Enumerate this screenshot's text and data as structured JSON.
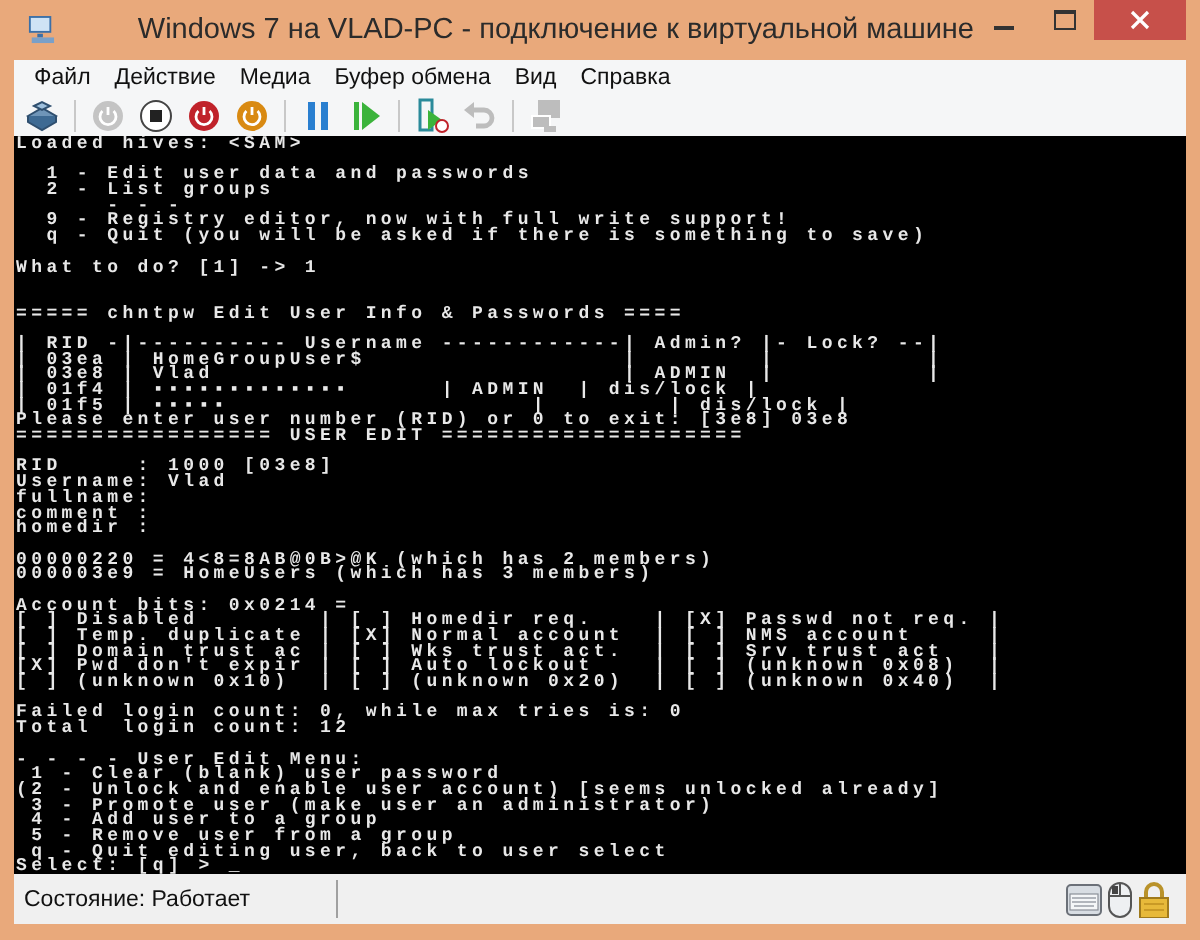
{
  "window": {
    "title": "Windows 7 на VLAD-PC - подключение к виртуальной машине"
  },
  "menu": [
    "Файл",
    "Действие",
    "Медиа",
    "Буфер обмена",
    "Вид",
    "Справка"
  ],
  "toolbar": [
    [
      {
        "kind": "ctrl-alt-del",
        "disabled": false
      }
    ],
    [
      {
        "kind": "start",
        "disabled": true
      },
      {
        "kind": "turn-off",
        "disabled": false
      },
      {
        "kind": "shut-down",
        "disabled": false
      },
      {
        "kind": "save",
        "disabled": false
      }
    ],
    [
      {
        "kind": "pause",
        "disabled": false
      },
      {
        "kind": "reset",
        "disabled": false
      }
    ],
    [
      {
        "kind": "checkpoint",
        "disabled": false
      },
      {
        "kind": "revert",
        "disabled": true
      }
    ],
    [
      {
        "kind": "enhanced-session",
        "disabled": true
      }
    ]
  ],
  "console": [
    {
      "wide_gap": false,
      "lines": [
        "Loaded hives: <SAM>"
      ]
    },
    {
      "wide_gap": false,
      "lines": [
        "  1 - Edit user data and passwords",
        "  2 - List groups",
        "      - - -",
        "  9 - Registry editor, now with full write support!",
        "  q - Quit (you will be asked if there is something to save)"
      ]
    },
    {
      "wide_gap": false,
      "lines": [
        "What to do? [1] -> 1"
      ]
    },
    {
      "wide_gap": true,
      "lines": [
        "===== chntpw Edit User Info & Passwords ===="
      ]
    },
    {
      "wide_gap": false,
      "lines": [
        "| RID -|---------- Username ------------| Admin? |- Lock? --|",
        "| 03ea | HomeGroupUser$                 |        |          |",
        "| 03e8 | Vlad                           | ADMIN  |          |",
        "| 01f4 | ▪▪▪▪▪▪▪▪▪▪▪▪▪      | ADMIN  | dis/lock |",
        "| 01f5 | ▪▪▪▪▪                    |        | dis/lock |",
        "Please enter user number (RID) or 0 to exit: [3e8] 03e8",
        "================= USER EDIT ===================="
      ]
    },
    {
      "wide_gap": false,
      "lines": [
        "RID     : 1000 [03e8]",
        "Username: Vlad",
        "fullname:",
        "comment :",
        "homedir :"
      ]
    },
    {
      "wide_gap": false,
      "lines": [
        "00000220 = 4<8=8AB@0B>@K (which has 2 members)",
        "000003e9 = HomeUsers (which has 3 members)"
      ]
    },
    {
      "wide_gap": false,
      "lines": [
        "Account bits: 0x0214 =",
        "[ ] Disabled        | [ ] Homedir req.    | [X] Passwd not req. |",
        "[ ] Temp. duplicate | [X] Normal account  | [ ] NMS account     |",
        "[ ] Domain trust ac | [ ] Wks trust act.  | [ ] Srv trust act   |",
        "[X] Pwd don't expir | [ ] Auto lockout    | [ ] (unknown 0x08)  |",
        "[ ] (unknown 0x10)  | [ ] (unknown 0x20)  | [ ] (unknown 0x40)  |"
      ]
    },
    {
      "wide_gap": false,
      "lines": [
        "Failed login count: 0, while max tries is: 0",
        "Total  login count: 12"
      ]
    },
    {
      "wide_gap": false,
      "lines": [
        "- - - - User Edit Menu:",
        " 1 - Clear (blank) user password",
        "(2 - Unlock and enable user account) [seems unlocked already]",
        " 3 - Promote user (make user an administrator)",
        " 4 - Add user to a group",
        " 5 - Remove user from a group",
        " q - Quit editing user, back to user select",
        "Select: [q] > _"
      ]
    }
  ],
  "status_bar": {
    "text": "Состояние: Работает"
  }
}
